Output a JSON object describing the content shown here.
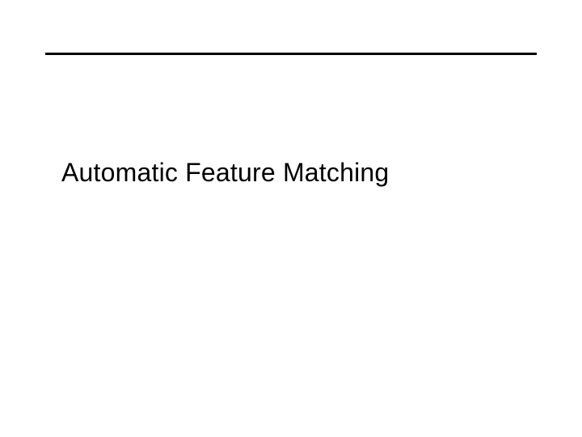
{
  "slide": {
    "title": "Automatic Feature Matching"
  }
}
